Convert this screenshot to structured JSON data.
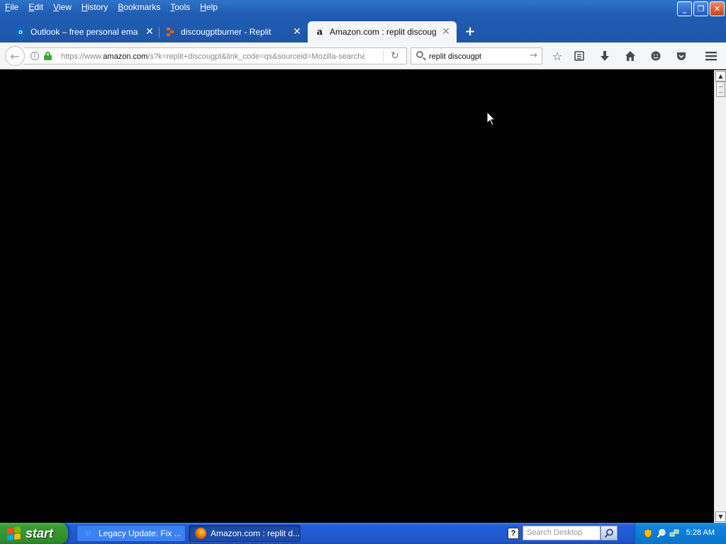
{
  "menu": {
    "items": [
      {
        "label": "File",
        "key": "F",
        "rest": "ile"
      },
      {
        "label": "Edit",
        "key": "E",
        "rest": "dit"
      },
      {
        "label": "View",
        "key": "V",
        "rest": "iew"
      },
      {
        "label": "History",
        "key": "H",
        "rest": "istory"
      },
      {
        "label": "Bookmarks",
        "key": "B",
        "rest": "ookmarks"
      },
      {
        "label": "Tools",
        "key": "T",
        "rest": "ools"
      },
      {
        "label": "Help",
        "key": "H",
        "rest": "elp"
      }
    ]
  },
  "window_controls": {
    "minimize": "_",
    "restore": "❐",
    "close": "✕"
  },
  "tabs": [
    {
      "label": "Outlook – free personal email a...",
      "favicon": "outlook-icon",
      "active": false
    },
    {
      "label": "discougptburner - Replit",
      "favicon": "replit-icon",
      "active": false
    },
    {
      "label": "Amazon.com : replit discougpt",
      "favicon": "amazon-icon",
      "active": true
    }
  ],
  "tab_close_glyph": "✕",
  "new_tab_glyph": "+",
  "navbar": {
    "back_glyph": "←",
    "url_prefix": "https://www.",
    "url_domain": "amazon.com",
    "url_suffix": "/s?k=replit+discougpt&link_code=qs&sourceid=Mozilla-search&ta",
    "reload_glyph": "↻",
    "search_value": "replit discougpt",
    "search_go_glyph": "→",
    "toolbar_icons": [
      "bookmark-star-icon",
      "reading-list-icon",
      "downloads-icon",
      "home-icon",
      "hello-icon",
      "pocket-icon",
      "hamburger-menu-icon"
    ]
  },
  "taskbar": {
    "start_label": "start",
    "tasks": [
      {
        "label": "Legacy Update: Fix ...",
        "icon": "ie-icon",
        "active": false
      },
      {
        "label": "Amazon.com : replit d...",
        "icon": "firefox-icon",
        "active": true
      }
    ],
    "help_glyph": "?",
    "search_placeholder": "Search Desktop",
    "clock": "5:28 AM"
  },
  "colors": {
    "titlebar": "#1f5db3",
    "toolbar": "#f5f6f7",
    "content_bg": "#000000",
    "taskbar": "#245edb",
    "start_green": "#3b9a35",
    "tray": "#0f83de",
    "lock_green": "#3aa935"
  }
}
